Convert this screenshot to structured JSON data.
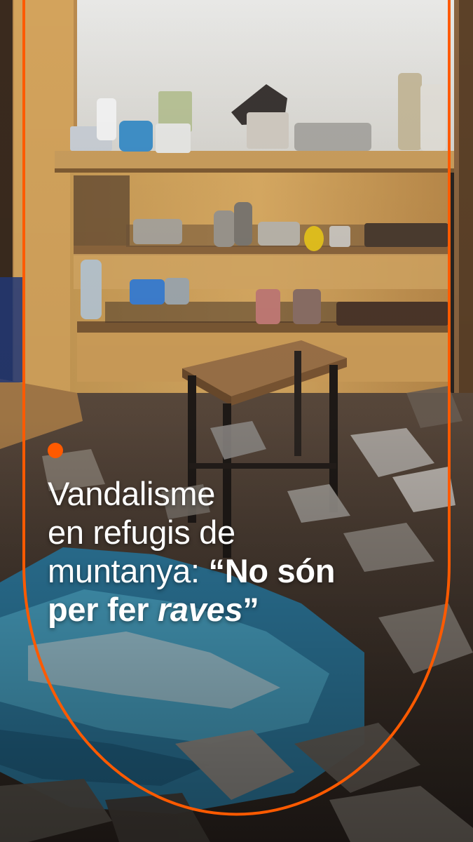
{
  "headline": {
    "line1": "Vandalisme",
    "line2": "en refugis de",
    "line3_regular": "muntanya: ",
    "line3_bold": "“No són",
    "line4_bold": "per fer ",
    "line4_italic": "raves",
    "line4_close": "”"
  },
  "colors": {
    "accent": "#ff5a00",
    "text": "#ffffff"
  }
}
